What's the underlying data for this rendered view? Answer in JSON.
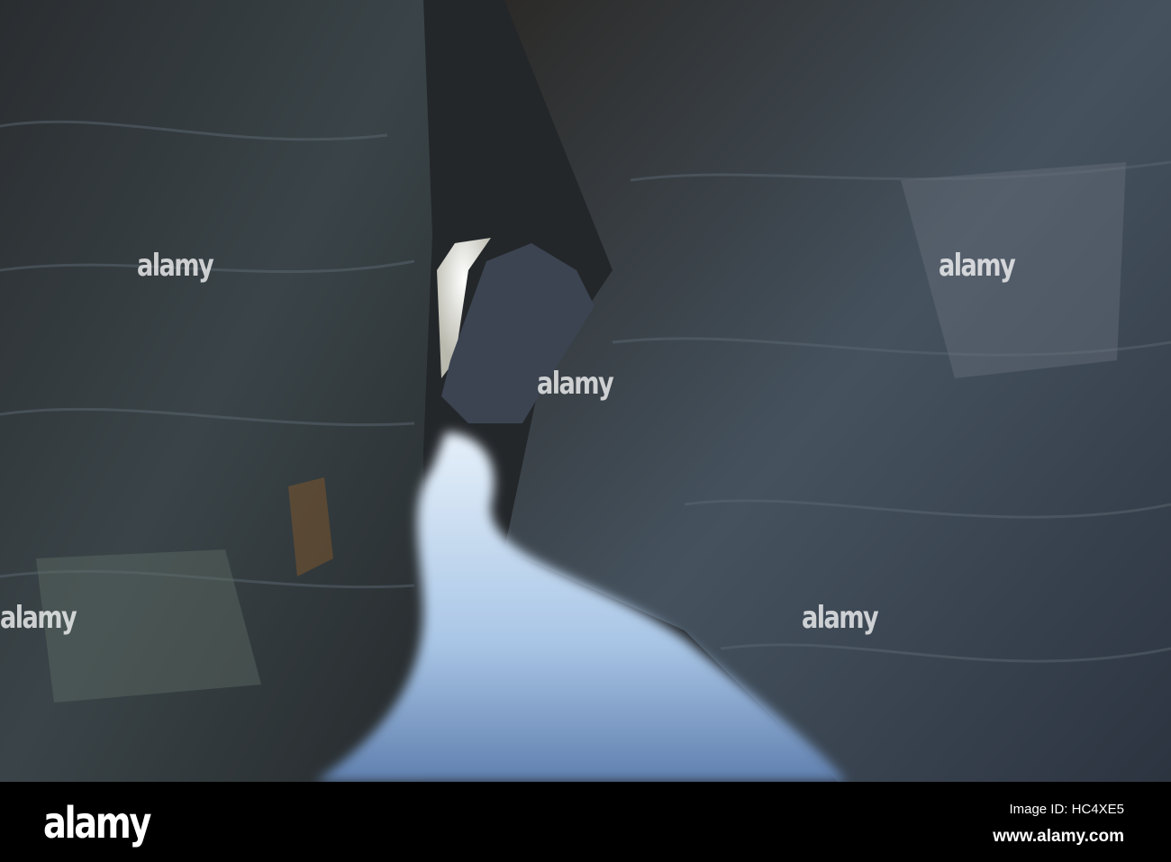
{
  "photo": {
    "subject": "sea cave",
    "colors": {
      "rock_dark": "#1e2226",
      "rock_mid": "#3f4a52",
      "rock_blue": "#5a6e82",
      "water": "#cfe3f5",
      "opening": "#f2f2ea"
    }
  },
  "watermark": {
    "text": "alamy"
  },
  "footer": {
    "logo": "alamy",
    "image_id": "Image ID: HC4XE5",
    "website": "www.alamy.com"
  }
}
